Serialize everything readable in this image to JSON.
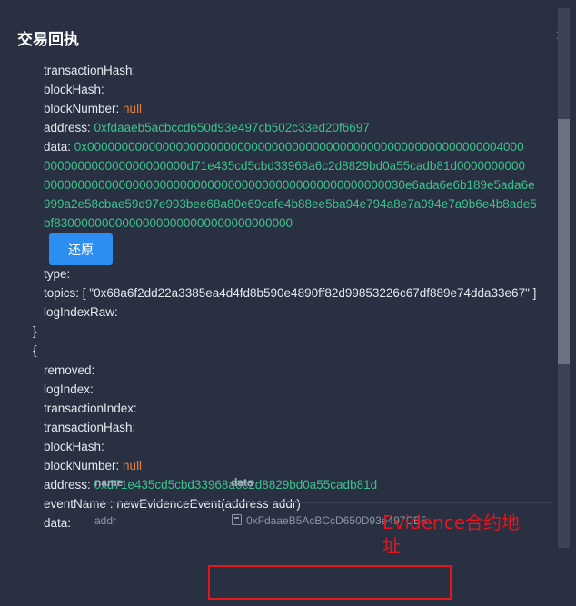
{
  "dialog": {
    "title": "交易回执",
    "close_symbol": "×"
  },
  "log1": {
    "transactionHash_key": "transactionHash:",
    "blockHash_key": "blockHash:",
    "blockNumber_key": "blockNumber:",
    "blockNumber_val": "null",
    "address_key": "address:",
    "address_val": "0xfdaaeb5acbccd650d93e497cb502c33ed20f6697",
    "data_key": "data:",
    "data_lines": [
      "0x0000000000000000000000000000000000000000000000000000000000004000",
      "000000000000000000000d71e435cd5cbd33968a6c2d8829bd0a55cadb81d0000000000",
      "00000000000000000000000000000000000000000000000000030e6ada6e6b189e5ada6e",
      "999a2e58cbae59d97e993bee68a80e69cafe4b88ee5ba94e794a8e7a094e7a9b6e4b8ade5",
      "bf83000000000000000000000000000000000"
    ],
    "restore_label": "还原",
    "type_key": "type:",
    "topics_key": "topics:",
    "topics_val": "[ \"0x68a6f2dd22a3385ea4d4fd8b590e4890ff82d99853226c67df889e74dda33e67\" ]",
    "logIndexRaw_key": "logIndexRaw:",
    "close_brace": "}"
  },
  "log2": {
    "open_brace": "{",
    "removed_key": "removed:",
    "logIndex_key": "logIndex:",
    "transactionIndex_key": "transactionIndex:",
    "transactionHash_key": "transactionHash:",
    "blockHash_key": "blockHash:",
    "blockNumber_key": "blockNumber:",
    "blockNumber_val": "null",
    "address_key": "address:",
    "address_val": "0xd71e435cd5cbd33968a6c2d8829bd0a55cadb81d",
    "eventName_key": "eventName :",
    "eventName_val": "newEvidenceEvent(address addr)",
    "data_key": "data:"
  },
  "decoded_table": {
    "headers": [
      "name",
      "data"
    ],
    "rows": [
      {
        "name": "addr",
        "data": "0xFdaaeB5AcBCcD650D93e497CB5..."
      }
    ]
  },
  "annotation": {
    "text": "Evidence合约地址",
    "color": "#e5151c"
  },
  "colors": {
    "accent_button": "#2c8ef0",
    "value_green": "#3dc28d",
    "null_orange": "#e5803c"
  }
}
